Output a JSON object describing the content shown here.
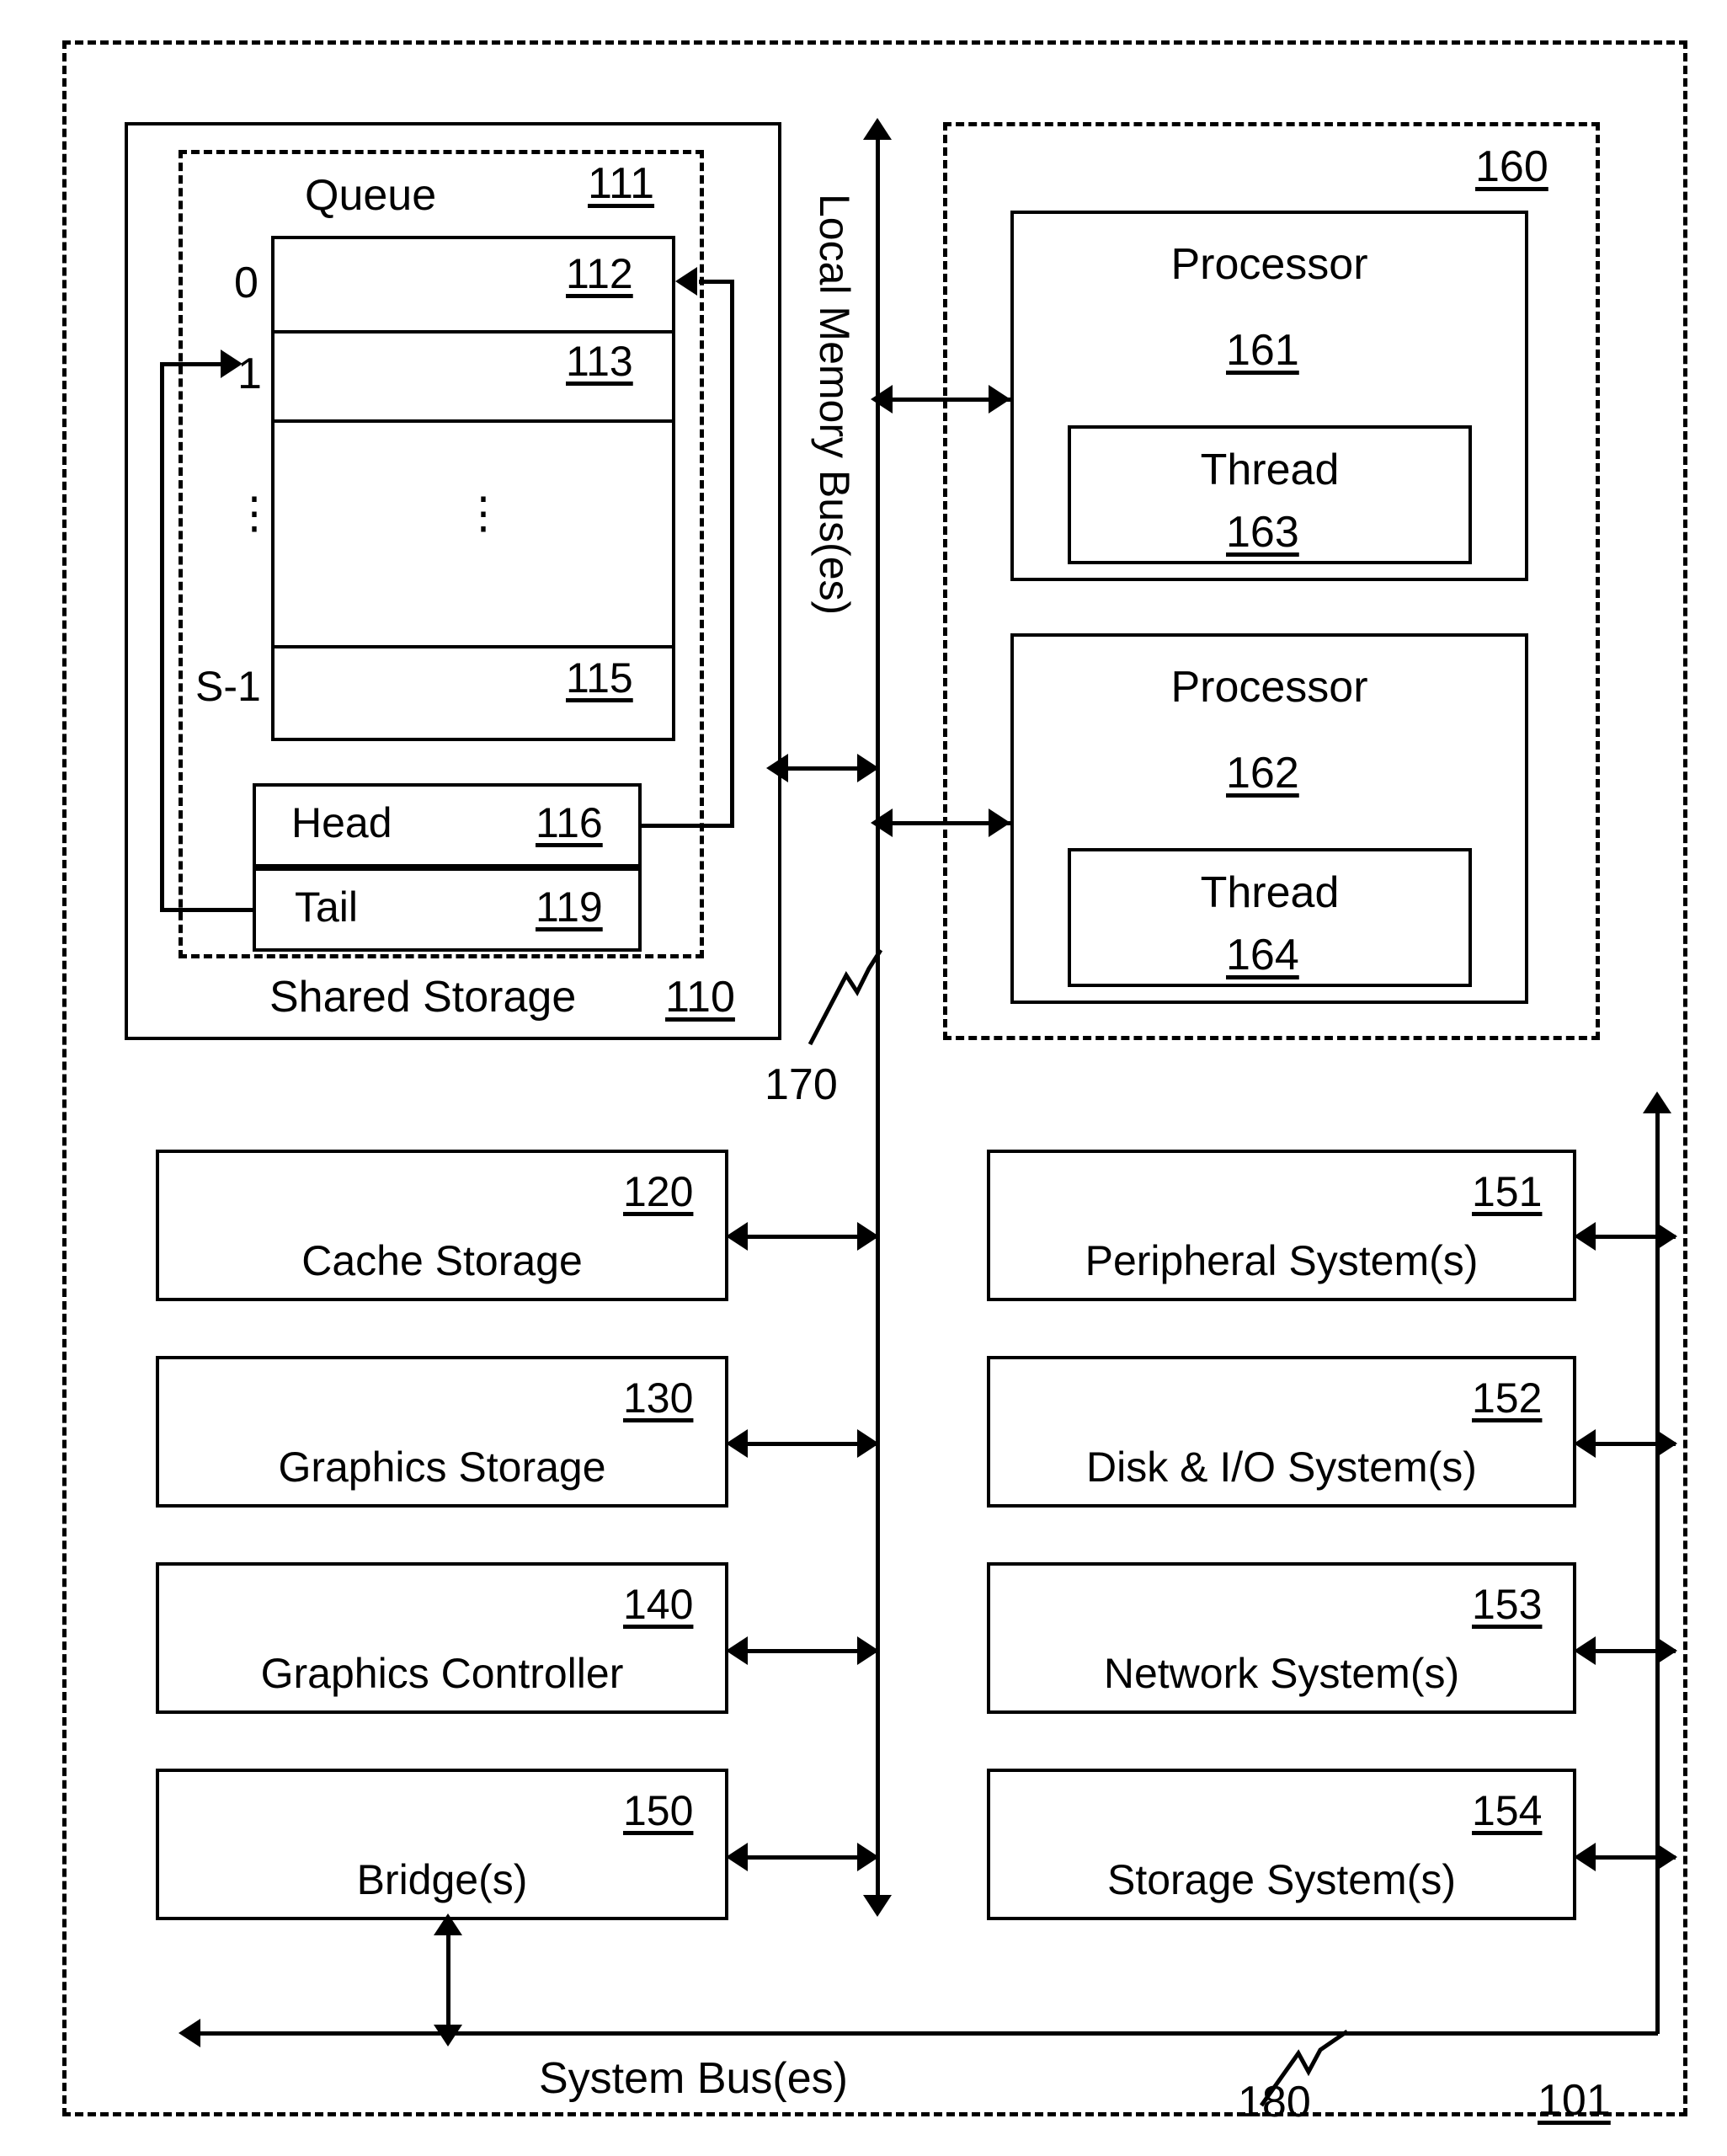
{
  "figure": {
    "outer_ref": "101",
    "shared_storage": {
      "label": "Shared Storage",
      "ref": "110",
      "queue": {
        "title": "Queue",
        "ref": "111",
        "row_labels": [
          "0",
          "1",
          "⋮",
          "S-1"
        ],
        "cell_refs": [
          "112",
          "113",
          "",
          "115"
        ],
        "ellipsis": "⋮"
      },
      "pointers": [
        {
          "label": "Head",
          "ref": "116"
        },
        {
          "label": "Tail",
          "ref": "119"
        }
      ]
    },
    "local_memory_bus": {
      "label": "Local Memory Bus(es)",
      "ref": "170"
    },
    "system_bus": {
      "label": "System Bus(es)",
      "ref": "180"
    },
    "processor_group": {
      "ref": "160",
      "processors": [
        {
          "label": "Processor",
          "ref": "161",
          "thread": {
            "label": "Thread",
            "ref": "163"
          }
        },
        {
          "label": "Processor",
          "ref": "162",
          "thread": {
            "label": "Thread",
            "ref": "164"
          }
        }
      ]
    },
    "left_column": [
      {
        "label": "Cache Storage",
        "ref": "120"
      },
      {
        "label": "Graphics Storage",
        "ref": "130"
      },
      {
        "label": "Graphics Controller",
        "ref": "140"
      },
      {
        "label": "Bridge(s)",
        "ref": "150"
      }
    ],
    "right_column": [
      {
        "label": "Peripheral System(s)",
        "ref": "151"
      },
      {
        "label": "Disk & I/O System(s)",
        "ref": "152"
      },
      {
        "label": "Network System(s)",
        "ref": "153"
      },
      {
        "label": "Storage System(s)",
        "ref": "154"
      }
    ],
    "colors": {
      "ink": "#000000",
      "paper": "#ffffff"
    }
  }
}
